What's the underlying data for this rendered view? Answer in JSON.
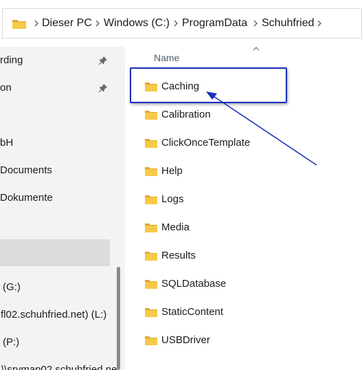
{
  "address_bar": {
    "crumbs": [
      "Dieser PC",
      "Windows (C:)",
      "ProgramData",
      "Schuhfried"
    ]
  },
  "nav": {
    "items": [
      {
        "label": "rding",
        "pinned": true
      },
      {
        "label": "on",
        "pinned": true
      },
      {
        "label": "bH"
      },
      {
        "label": "Documents"
      },
      {
        "label": "Dokumente"
      },
      {
        "label": ""
      },
      {
        "label": "(G:)"
      },
      {
        "label": "fl02.schuhfried.net) (L:)"
      },
      {
        "label": "(P:)"
      },
      {
        "label": "\\\\srvmap02.schuhfried.ne"
      }
    ],
    "selected_index": 5
  },
  "list": {
    "column_header": "Name",
    "folders": [
      "Caching",
      "Calibration",
      "ClickOnceTemplate",
      "Help",
      "Logs",
      "Media",
      "Results",
      "SQLDatabase",
      "StaticContent",
      "USBDriver"
    ],
    "highlighted": "Caching"
  },
  "colors": {
    "folder": "#f7c948",
    "folder_dark": "#e0a928",
    "annotation": "#1a2fb8"
  }
}
